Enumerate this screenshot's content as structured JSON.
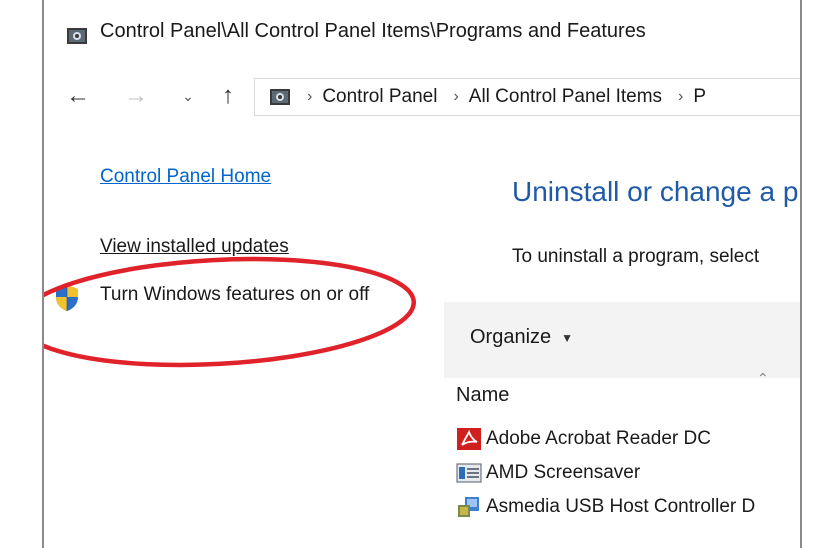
{
  "window": {
    "title": "Control Panel\\All Control Panel Items\\Programs and Features"
  },
  "nav": {
    "back_icon": "back-arrow-icon",
    "forward_icon": "forward-arrow-icon",
    "recent_icon": "chevron-down-icon",
    "up_icon": "up-arrow-icon",
    "breadcrumbs": [
      "Control Panel",
      "All Control Panel Items",
      "P"
    ]
  },
  "sidebar": {
    "home_link": "Control Panel Home",
    "updates_link": "View installed updates",
    "features_link": "Turn Windows features on or off",
    "highlight_color": "#e0222b"
  },
  "main": {
    "heading": "Uninstall or change a p",
    "instruction": "To uninstall a program, select",
    "toolbar": {
      "organize_label": "Organize"
    },
    "column_header": "Name",
    "programs": [
      {
        "name": "Adobe Acrobat Reader DC",
        "icon": "acrobat-icon"
      },
      {
        "name": "AMD Screensaver",
        "icon": "screensaver-icon"
      },
      {
        "name": "Asmedia USB Host Controller D",
        "icon": "installer-icon"
      }
    ]
  },
  "colors": {
    "link_blue": "#0066cc",
    "heading_blue": "#1e5aa8",
    "toolbar_bg": "#f3f3f3"
  }
}
